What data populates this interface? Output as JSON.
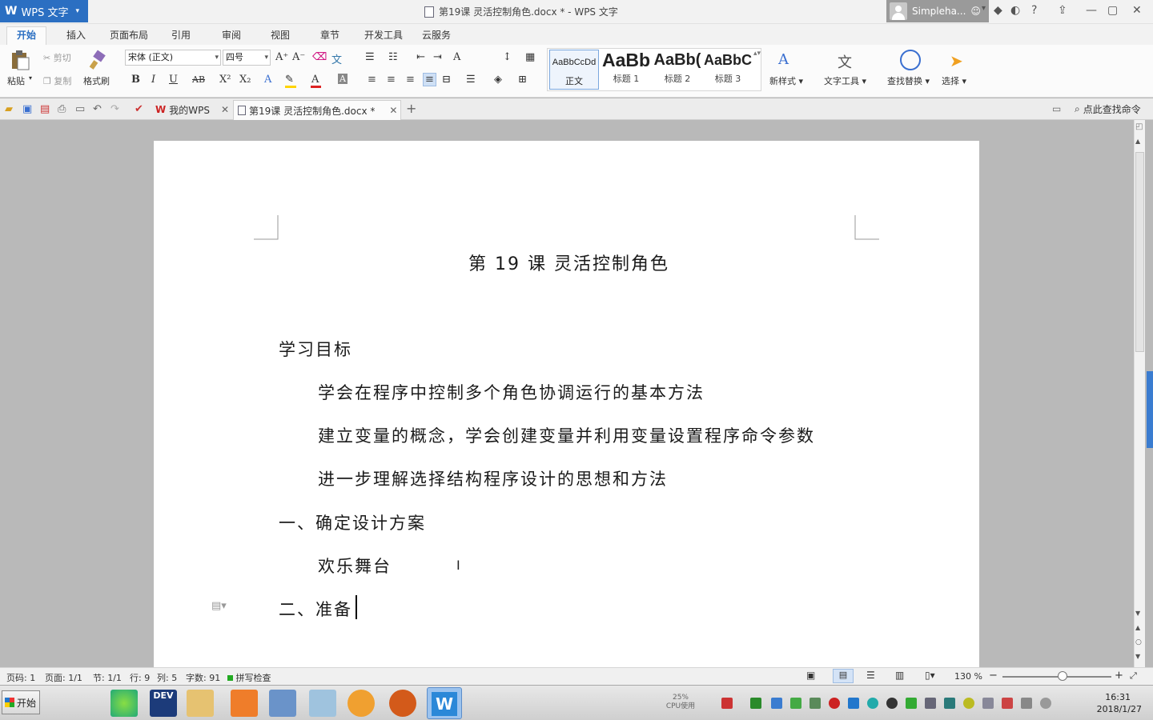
{
  "window": {
    "app_menu": "WPS 文字",
    "title": "第19课  灵活控制角色.docx * - WPS 文字",
    "user_name": "Simpleha..."
  },
  "menu_tabs": [
    "开始",
    "插入",
    "页面布局",
    "引用",
    "审阅",
    "视图",
    "章节",
    "开发工具",
    "云服务"
  ],
  "ribbon": {
    "paste": "粘贴",
    "cut": "剪切",
    "copy": "复制",
    "format_painter": "格式刷",
    "font_name": "宋体 (正文)",
    "font_size": "四号",
    "styles": [
      {
        "preview": "AaBbCcDd",
        "name": "正文"
      },
      {
        "preview": "AaBb",
        "name": "标题 1"
      },
      {
        "preview": "AaBb(",
        "name": "标题 2"
      },
      {
        "preview": "AaBbC",
        "name": "标题 3"
      }
    ],
    "new_style": "新样式",
    "text_tools": "文字工具",
    "find_replace": "查找替换",
    "select": "选择"
  },
  "doc_tabs": {
    "home_tab": "我的WPS",
    "active_tab": "第19课  灵活控制角色.docx *",
    "search_cmd": "点此查找命令"
  },
  "document": {
    "heading": "第 19 课  灵活控制角色",
    "section_goals": "学习目标",
    "goal_1": "学会在程序中控制多个角色协调运行的基本方法",
    "goal_2": "建立变量的概念，学会创建变量并利用变量设置程序命令参数",
    "goal_3": "进一步理解选择结构程序设计的思想和方法",
    "section_1": "一、确定设计方案",
    "section_1_item": "欢乐舞台",
    "section_2": "二、准备"
  },
  "status": {
    "page_num": "页码: 1",
    "pages": "页面: 1/1",
    "section": "节: 1/1",
    "row": "行: 9",
    "col": "列: 5",
    "word_count": "字数: 91",
    "spell_check": "拼写检查",
    "zoom": "130 %",
    "zoom_level": 0.55
  },
  "taskbar": {
    "start": "开始",
    "cpu_percent": "25%",
    "cpu_label": "CPU使用",
    "time": "16:31",
    "date": "2018/1/27"
  },
  "colors": {
    "accent": "#2b6fc2",
    "page_bg": "#b9b9b9"
  }
}
